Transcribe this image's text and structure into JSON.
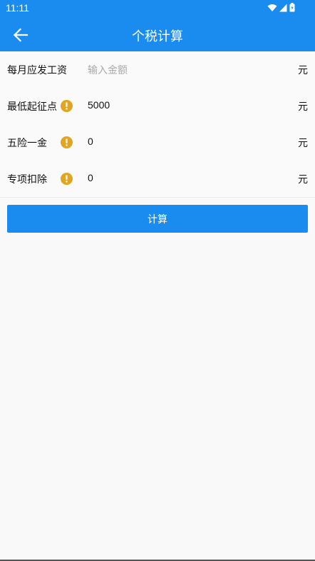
{
  "status_bar": {
    "time": "11:11"
  },
  "appbar": {
    "title": "个税计算",
    "back_icon": "arrow-left-icon"
  },
  "form": {
    "rows": [
      {
        "label": "每月应发工资",
        "value": "",
        "placeholder": "输入金额",
        "unit": "元",
        "info": false
      },
      {
        "label": "最低起征点",
        "value": "5000",
        "placeholder": "",
        "unit": "元",
        "info": true
      },
      {
        "label": "五险一金",
        "value": "0",
        "placeholder": "",
        "unit": "元",
        "info": true
      },
      {
        "label": "专项扣除",
        "value": "0",
        "placeholder": "",
        "unit": "元",
        "info": true
      }
    ]
  },
  "calculate_button": {
    "label": "计算"
  },
  "colors": {
    "accent": "#1a8cf0",
    "info": "#e0a521",
    "background": "#f9f9f9"
  }
}
